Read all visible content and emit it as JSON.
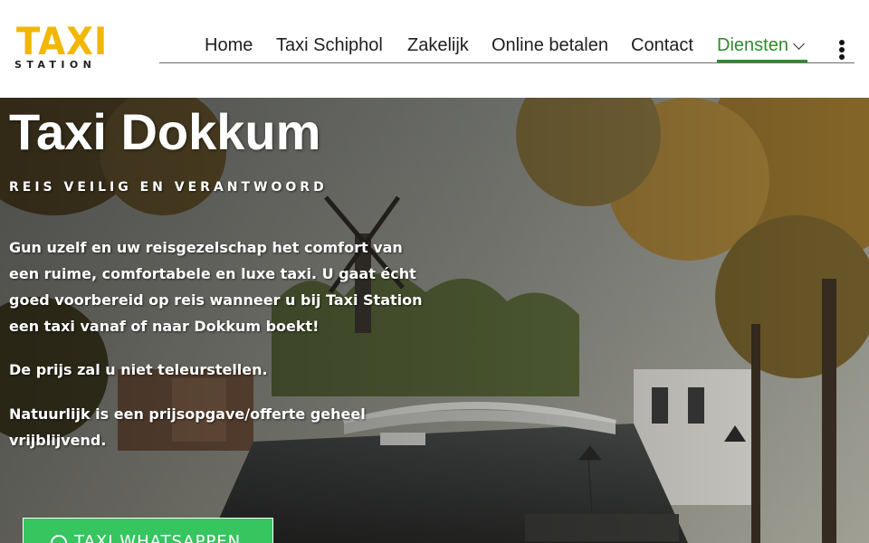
{
  "logo": {
    "word": "TAXI",
    "subword": "STATION"
  },
  "nav": {
    "items": [
      {
        "label": "Home"
      },
      {
        "label": "Taxi Schiphol"
      },
      {
        "label": "Zakelijk"
      },
      {
        "label": "Online betalen"
      },
      {
        "label": "Contact"
      },
      {
        "label": "Diensten",
        "active": true
      }
    ],
    "more_icon": "kebab-menu-icon",
    "dropdown_icon": "chevron-down-icon",
    "active_color": "#2f8a2f"
  },
  "hero": {
    "title": "Taxi Dokkum",
    "subtitle": "REIS VEILIG EN VERANTWOORD",
    "paragraph1": "Gun uzelf en uw reisgezelschap het comfort van een ruime, comfortabele en luxe taxi. U gaat écht goed voorbereid op reis wanneer u bij Taxi Station een taxi vanaf of naar Dokkum boekt!",
    "paragraph2": "De prijs zal u niet teleurstellen.",
    "paragraph3": "Natuurlijk is een prijsopgave/offerte geheel vrijblijvend.",
    "cta_label": "TAXI WHATSAPPEN",
    "cta_icon": "whatsapp-icon",
    "cta_color": "#36c55f"
  },
  "colors": {
    "logo_yellow": "#f2b705"
  }
}
